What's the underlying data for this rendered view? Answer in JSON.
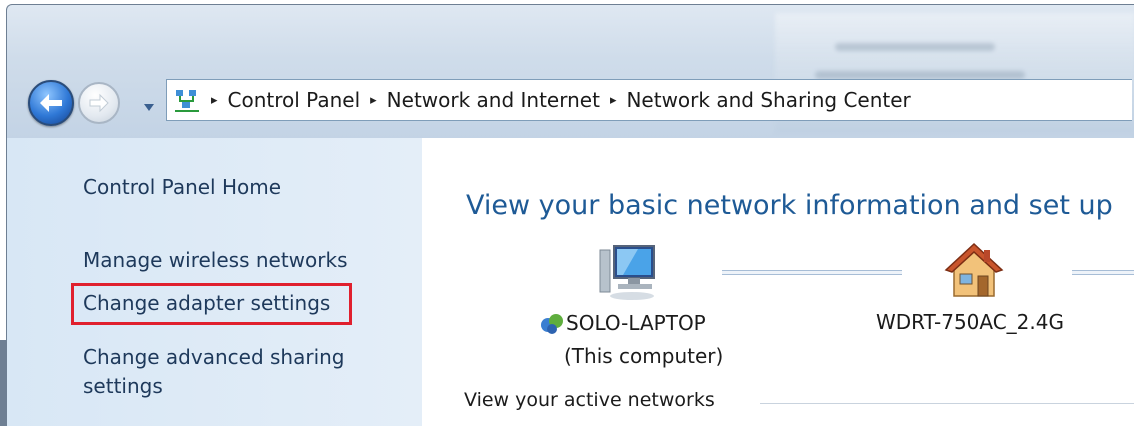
{
  "breadcrumb": {
    "items": [
      "Control Panel",
      "Network and Internet",
      "Network and Sharing Center"
    ],
    "separator": "▸"
  },
  "left_pane": {
    "home_link": "Control Panel Home",
    "wireless_link": "Manage wireless networks",
    "adapter_link": "Change adapter settings",
    "advanced_link": "Change advanced sharing settings"
  },
  "main": {
    "title": "View your basic network information and set up",
    "computer_name": "SOLO-LAPTOP",
    "computer_sub": "(This computer)",
    "router_name": "WDRT-750AC_2.4G",
    "active_networks_label": "View your active networks"
  },
  "colors": {
    "title_blue": "#1e5a96",
    "link_blue": "#1e395b",
    "highlight_red": "#e0202e",
    "left_pane_bg": "#d8e7f5"
  },
  "icons": {
    "back": "back-arrow-icon",
    "forward": "forward-arrow-icon",
    "history": "chevron-down-icon",
    "address": "network-center-icon",
    "computer": "computer-icon",
    "router": "house-icon",
    "computer_badge": "network-globe-icon"
  }
}
